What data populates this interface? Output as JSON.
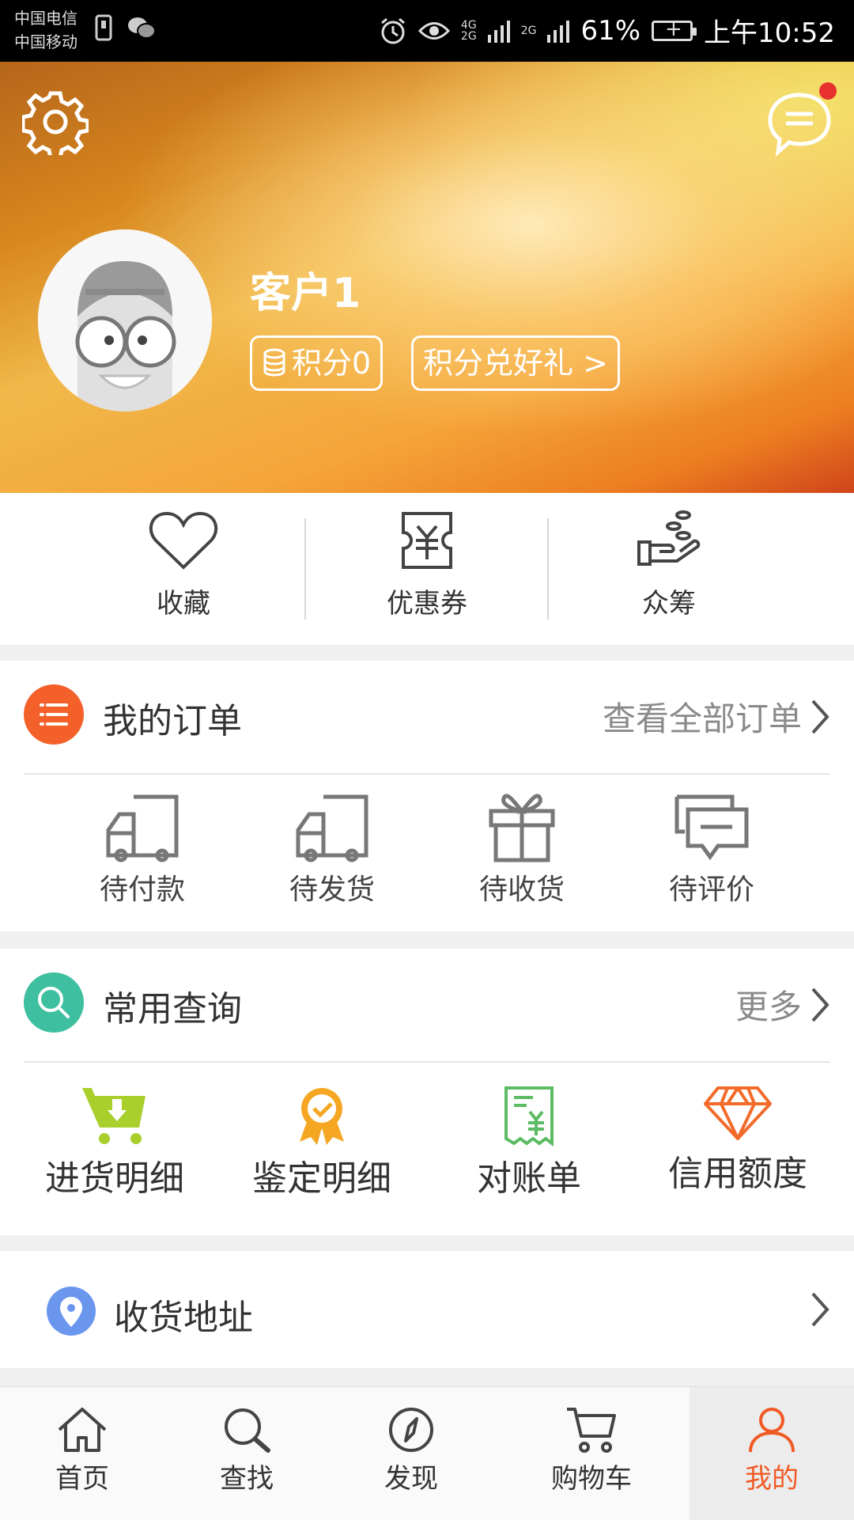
{
  "status_bar": {
    "carrier1": "中国电信",
    "carrier2": "中国移动",
    "net1": "4G",
    "net2": "2G",
    "net3": "2G",
    "battery": "61%",
    "time": "上午10:52"
  },
  "profile": {
    "username": "客户1",
    "points_label": "积分0",
    "exchange_label": "积分兑好礼 >"
  },
  "quick_links": [
    {
      "label": "收藏",
      "icon": "heart-icon"
    },
    {
      "label": "优惠券",
      "icon": "coupon-icon"
    },
    {
      "label": "众筹",
      "icon": "crowdfunding-icon"
    }
  ],
  "orders": {
    "title": "我的订单",
    "view_all": "查看全部订单",
    "items": [
      {
        "label": "待付款",
        "icon": "truck-icon"
      },
      {
        "label": "待发货",
        "icon": "truck-icon"
      },
      {
        "label": "待收货",
        "icon": "gift-icon"
      },
      {
        "label": "待评价",
        "icon": "comment-icon"
      }
    ]
  },
  "queries": {
    "title": "常用查询",
    "more": "更多",
    "items": [
      {
        "label": "进货明细",
        "icon": "cart-download-icon"
      },
      {
        "label": "鉴定明细",
        "icon": "award-icon"
      },
      {
        "label": "对账单",
        "icon": "receipt-icon"
      },
      {
        "label": "信用额度",
        "icon": "diamond-icon"
      }
    ]
  },
  "address": {
    "title": "收货地址"
  },
  "tabbar": [
    {
      "label": "首页",
      "icon": "home-icon"
    },
    {
      "label": "查找",
      "icon": "search-icon"
    },
    {
      "label": "发现",
      "icon": "compass-icon"
    },
    {
      "label": "购物车",
      "icon": "cart-icon"
    },
    {
      "label": "我的",
      "icon": "person-icon",
      "active": true
    }
  ],
  "colors": {
    "accent": "#f15a24",
    "orders_icon_bg": "#f4602a",
    "queries_icon_bg": "#3dbfa0",
    "address_icon": "#6a96ee",
    "notification_dot": "#e8312e"
  }
}
